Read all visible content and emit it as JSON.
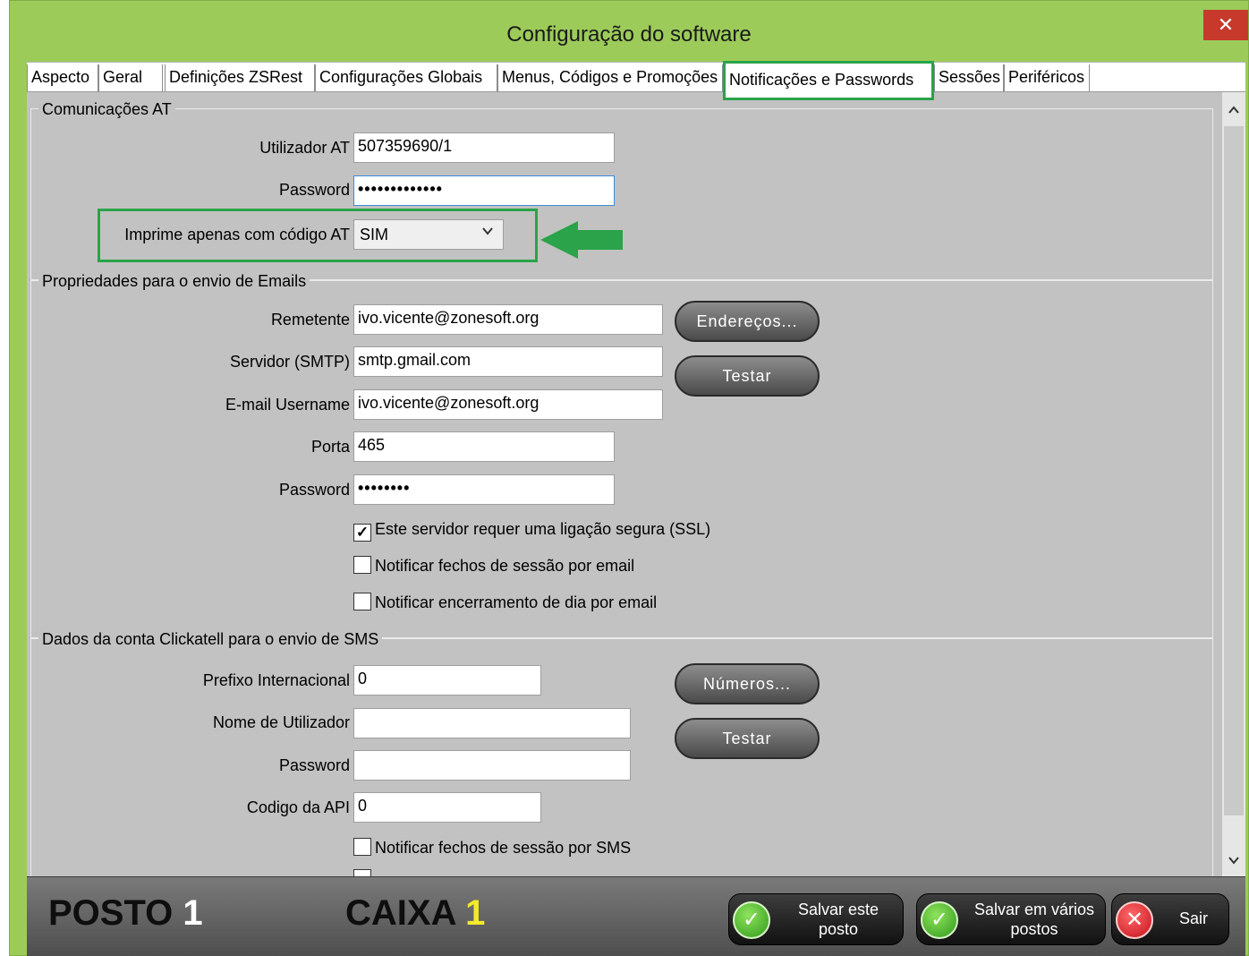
{
  "window": {
    "title": "Configuração do software",
    "close_glyph": "✕"
  },
  "tabs": [
    {
      "label": "Aspecto"
    },
    {
      "label": "Geral"
    },
    {
      "label": "Definições ZSRest"
    },
    {
      "label": "Configurações Globais"
    },
    {
      "label": "Menus, Códigos e Promoções"
    },
    {
      "label": "Notificações e Passwords",
      "active": true
    },
    {
      "label": "Sessões"
    },
    {
      "label": "Periféricos"
    }
  ],
  "at_group": {
    "title": "Comunicações AT",
    "user_label": "Utilizador AT",
    "user_value": "507359690/1",
    "password_label": "Password",
    "password_value": "•••••••••••••",
    "print_label": "Imprime apenas com código AT",
    "print_value": "SIM"
  },
  "email_group": {
    "title": "Propriedades para o envio de Emails",
    "sender_label": "Remetente",
    "sender_value": "ivo.vicente@zonesoft.org",
    "smtp_label": "Servidor (SMTP)",
    "smtp_value": "smtp.gmail.com",
    "username_label": "E-mail Username",
    "username_value": "ivo.vicente@zonesoft.org",
    "port_label": "Porta",
    "port_value": "465",
    "password_label": "Password",
    "password_value": "••••••••",
    "addresses_button": "Endereços...",
    "test_button": "Testar",
    "ssl_label": "Este servidor requer uma ligação segura (SSL)",
    "ssl_checked": true,
    "notify_sessions_label": "Notificar fechos de sessão por email",
    "notify_day_label": "Notificar encerramento de dia por email"
  },
  "sms_group": {
    "title": "Dados da conta Clickatell para o envio de SMS",
    "prefix_label": "Prefixo Internacional",
    "prefix_value": "0",
    "username_label": "Nome de Utilizador",
    "username_value": "",
    "password_label": "Password",
    "password_value": "",
    "api_label": "Codigo da API",
    "api_value": "0",
    "numbers_button": "Números...",
    "test_button": "Testar",
    "notify_sessions_label": "Notificar fechos de sessão por SMS"
  },
  "footer": {
    "posto_label": "POSTO",
    "posto_value": "1",
    "caixa_label": "CAIXA",
    "caixa_value": "1",
    "save_line1": "Salvar este",
    "save_line2": "posto",
    "save_many_line1": "Salvar em vários",
    "save_many_line2": "postos",
    "exit_label": "Sair"
  },
  "colors": {
    "window": "#9ccb5a",
    "highlight": "#2aa34a",
    "content": "#c2c2c2",
    "caixa_number": "#f2ea2a"
  },
  "icons": {
    "check": "✓",
    "close": "✕",
    "chevron_down": "⌄",
    "scroll_up": "⌃",
    "scroll_down": "⌄"
  }
}
